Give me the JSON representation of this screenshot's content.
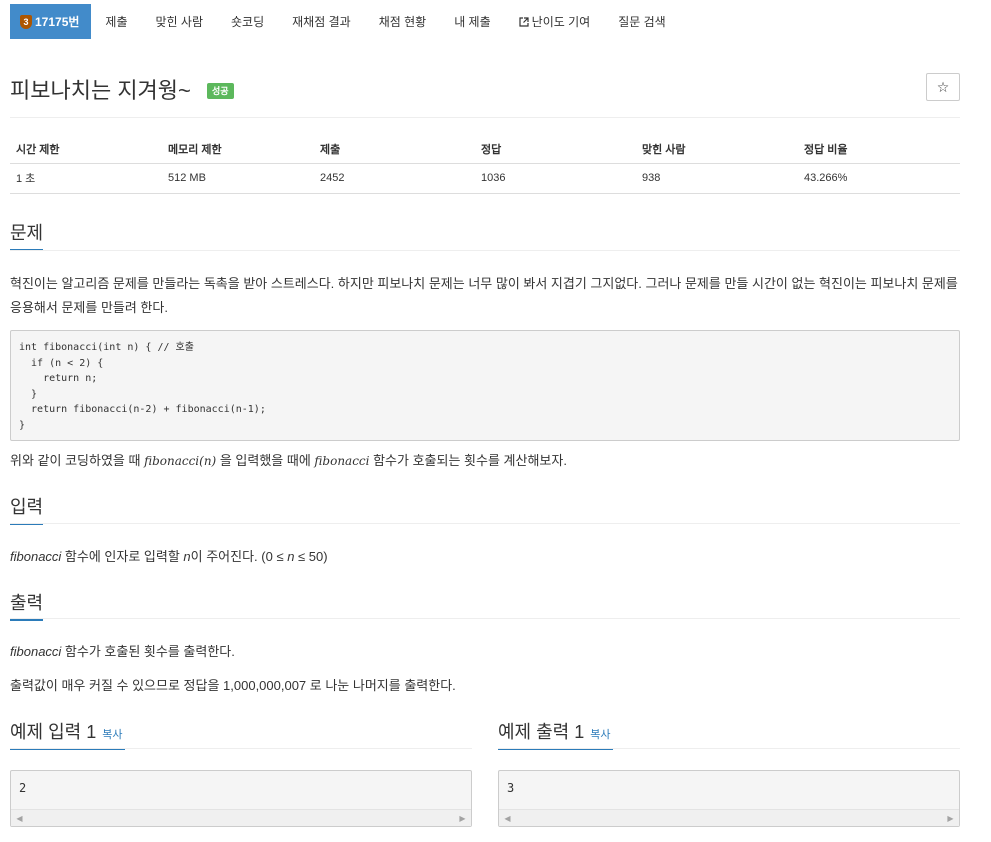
{
  "nav": {
    "problem_tab": {
      "tier_icon": "tier-badge-icon",
      "tier_label": "3",
      "label": "17175번"
    },
    "items": [
      "제출",
      "맞힌 사람",
      "숏코딩",
      "재채점 결과",
      "채점 현황",
      "내 제출",
      "난이도 기여",
      "질문 검색"
    ],
    "external_icon": "external-link-icon"
  },
  "problem": {
    "title": "피보나치는 지겨웡~",
    "status_badge": "성공",
    "star_icon": "☆"
  },
  "info_table": {
    "headers": [
      "시간 제한",
      "메모리 제한",
      "제출",
      "정답",
      "맞힌 사람",
      "정답 비율"
    ],
    "values": [
      "1 초",
      "512 MB",
      "2452",
      "1036",
      "938",
      "43.266%"
    ]
  },
  "description": {
    "heading": "문제",
    "text": "혁진이는 알고리즘 문제를 만들라는 독촉을 받아 스트레스다. 하지만 피보나치 문제는 너무 많이 봐서 지겹기 그지없다. 그러나 문제를 만들 시간이 없는 혁진이는 피보나치 문제를 응용해서 문제를 만들려 한다.",
    "code": "int fibonacci(int n) { // 호출\n  if (n < 2) {\n    return n;\n  }\n  return fibonacci(n-2) + fibonacci(n-1);\n}",
    "after_prefix": "위와 같이 코딩하였을 때 ",
    "after_math1": "fibonacci(n)",
    "after_mid": " 을 입력했을 때에 ",
    "after_math2": "fibonacci",
    "after_suffix": " 함수가 호출되는 횟수를 계산해보자."
  },
  "input": {
    "heading": "입력",
    "em": "fibonacci",
    "mid": " 함수에 인자로 입력할 ",
    "var": "n",
    "rest": "이 주어진다. (0 ≤ ",
    "var2": "n",
    "end": " ≤ 50)"
  },
  "output": {
    "heading": "출력",
    "line1_em": "fibonacci",
    "line1_rest": " 함수가 호출된 횟수를 출력한다.",
    "line2": "출력값이 매우 커질 수 있으므로 정답을 1,000,000,007 로 나눈 나머지를 출력한다."
  },
  "samples": {
    "input_heading": "예제 입력 1",
    "output_heading": "예제 출력 1",
    "copy_label": "복사",
    "input_value": "2",
    "output_value": "3"
  }
}
